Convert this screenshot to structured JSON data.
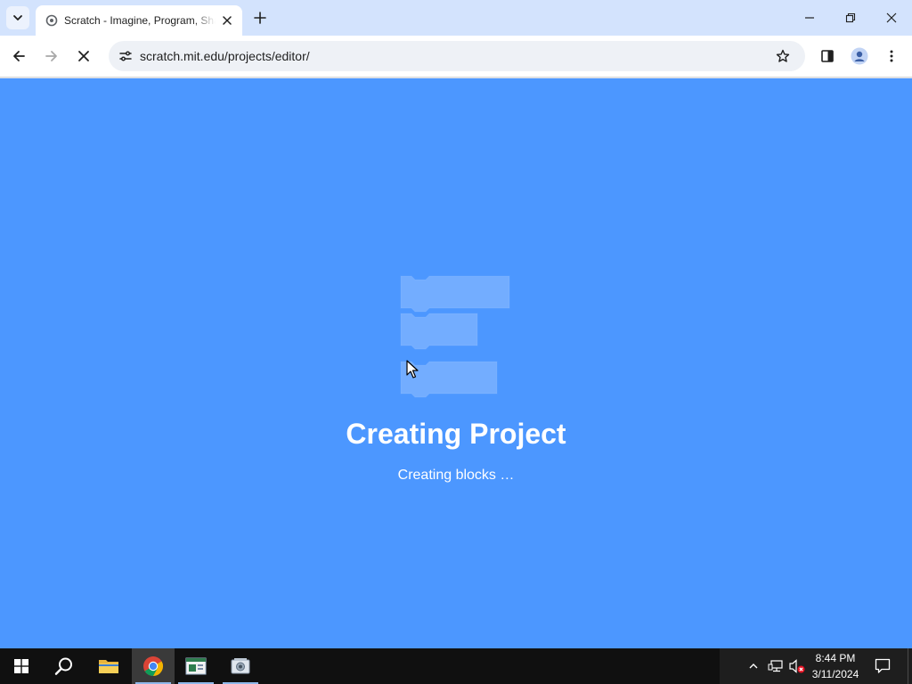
{
  "browser": {
    "tab": {
      "title": "Scratch - Imagine, Program, Share",
      "favicon": "scratch-favicon"
    },
    "address": {
      "url": "scratch.mit.edu/projects/editor/"
    },
    "colors": {
      "tabstrip": "#d3e3fd",
      "toolbar": "#ffffff"
    }
  },
  "page": {
    "background": "#4c97ff",
    "title": "Creating Project",
    "message": "Creating blocks …",
    "loader_icon": "code-blocks-loader"
  },
  "taskbar": {
    "apps": [
      {
        "name": "start",
        "icon": "windows-logo-icon"
      },
      {
        "name": "search",
        "icon": "search-icon"
      },
      {
        "name": "file-explorer",
        "icon": "folder-icon"
      },
      {
        "name": "chrome",
        "icon": "chrome-icon",
        "active": true
      },
      {
        "name": "app-window",
        "icon": "app-window-icon"
      },
      {
        "name": "image-viewer",
        "icon": "photo-app-icon"
      }
    ],
    "clock": {
      "time": "8:44 PM",
      "date": "3/11/2024"
    },
    "tray_icons": [
      "chevron-up-icon",
      "network-icon",
      "volume-muted-icon"
    ]
  }
}
